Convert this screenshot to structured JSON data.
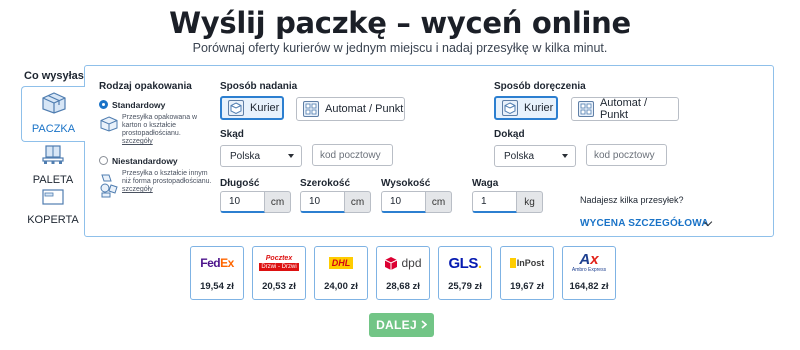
{
  "header": {
    "title": "Wyślij paczkę – wyceń online",
    "subtitle": "Porównaj oferty kurierów w jednym miejscu i nadaj przesyłkę w kilka minut."
  },
  "shipment_types": {
    "label": "Co wysyłasz?",
    "items": [
      {
        "label": "PACZKA",
        "icon": "package-icon",
        "active": true
      },
      {
        "label": "PALETA",
        "icon": "pallet-icon",
        "active": false
      },
      {
        "label": "KOPERTA",
        "icon": "envelope-icon",
        "active": false
      }
    ]
  },
  "packaging": {
    "title": "Rodzaj opakowania",
    "options": [
      {
        "label": "Standardowy",
        "description": "Przesyłka opakowana w karton o kształcie prostopadłościanu.",
        "link": "szczegóły",
        "checked": true
      },
      {
        "label": "Niestandardowy",
        "description": "Przesyłka o kształcie innym niż forma prostopadłościanu.",
        "link": "szczegóły",
        "checked": false
      }
    ]
  },
  "sending": {
    "title": "Sposób nadania",
    "options": [
      {
        "label": "Kurier",
        "active": true
      },
      {
        "label": "Automat / Punkt",
        "active": false
      }
    ],
    "from_label": "Skąd",
    "country": "Polska",
    "postcode_placeholder": "kod pocztowy"
  },
  "delivery": {
    "title": "Sposób doręczenia",
    "options": [
      {
        "label": "Kurier",
        "active": true
      },
      {
        "label": "Automat / Punkt",
        "active": false
      }
    ],
    "to_label": "Dokąd",
    "country": "Polska",
    "postcode_placeholder": "kod pocztowy"
  },
  "dimensions": {
    "length": {
      "label": "Długość",
      "value": "10",
      "unit": "cm"
    },
    "width": {
      "label": "Szerokość",
      "value": "10",
      "unit": "cm"
    },
    "height": {
      "label": "Wysokość",
      "value": "10",
      "unit": "cm"
    },
    "weight": {
      "label": "Waga",
      "value": "1",
      "unit": "kg"
    }
  },
  "multi_parcel": {
    "text": "Nadajesz kilka przesyłek?",
    "detail_link": "WYCENA SZCZEGÓŁOWA"
  },
  "carriers": [
    {
      "name": "FedEx",
      "price": "19,54 zł"
    },
    {
      "name": "Pocztex",
      "sub": "Drzwi - Drzwi",
      "price": "20,53 zł"
    },
    {
      "name": "DHL",
      "price": "24,00 zł"
    },
    {
      "name": "dpd",
      "price": "28,68 zł"
    },
    {
      "name": "GLS.",
      "price": "25,79 zł"
    },
    {
      "name": "InPost",
      "price": "19,67 zł"
    },
    {
      "name": "Ambro Express",
      "price": "164,82 zł"
    }
  ],
  "actions": {
    "next_label": "DALEJ"
  },
  "colors": {
    "accent": "#1a73c7",
    "panel_border": "#8fc0ea",
    "next_button": "#72c586"
  }
}
